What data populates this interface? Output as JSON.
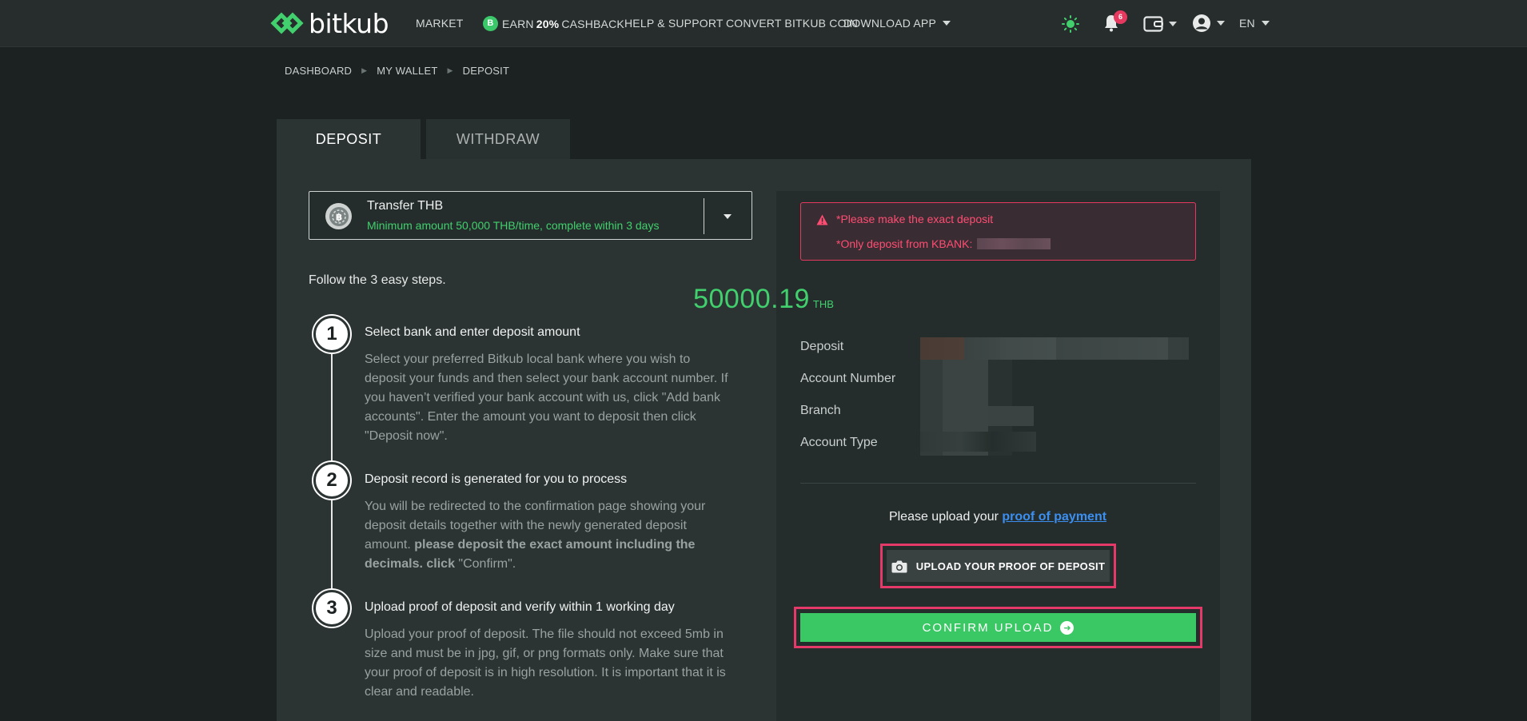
{
  "brand": {
    "name": "bitkub"
  },
  "nav": {
    "market": "MARKET",
    "earn_prefix": "EARN",
    "earn_bold": "20%",
    "earn_suffix": "CASHBACK",
    "earn_coin": "B",
    "help": "HELP & SUPPORT",
    "convert": "CONVERT BITKUB COIN",
    "download": "DOWNLOAD APP",
    "notifications_count": "6",
    "language": "EN"
  },
  "breadcrumb": [
    "DASHBOARD",
    "MY WALLET",
    "DEPOSIT"
  ],
  "tabs": {
    "deposit": "DEPOSIT",
    "withdraw": "WITHDRAW"
  },
  "method": {
    "title": "Transfer THB",
    "subtitle": "Minimum amount 50,000 THB/time, complete within 3 days"
  },
  "steps_intro": "Follow the 3 easy steps.",
  "steps": [
    {
      "num": "1",
      "title": "Select bank and enter deposit amount",
      "desc": "Select your preferred Bitkub local bank where you wish to deposit your funds and then select your bank account number. If you haven’t verified your bank account with us, click \"Add bank accounts\". Enter the amount you want to deposit then click \"Deposit now\"."
    },
    {
      "num": "2",
      "title": "Deposit record is generated for you to process",
      "desc_pre": "You will be redirected to the confirmation page showing your deposit details together with the newly generated deposit amount. ",
      "desc_bold": "please deposit the exact amount including the decimals. click",
      "desc_post": " \"Confirm\"."
    },
    {
      "num": "3",
      "title": "Upload proof of deposit and verify within 1 working day",
      "desc": "Upload your proof of deposit. The file should not exceed 5mb in size and must be in jpg, gif, or png formats only. Make sure that your proof of deposit is in high resolution. It is important that it is clear and readable."
    }
  ],
  "alert": {
    "line1": "*Please make the exact deposit",
    "line2": "*Only deposit from KBANK:"
  },
  "amount": {
    "value": "50000.19",
    "unit": "THB"
  },
  "details": {
    "deposit_label": "Deposit",
    "account_number_label": "Account Number",
    "branch_label": "Branch",
    "account_type_label": "Account Type"
  },
  "upload": {
    "prompt": "Please upload your",
    "link": "proof of payment",
    "button": "UPLOAD YOUR PROOF OF DEPOSIT"
  },
  "confirm": {
    "label": "CONFIRM UPLOAD"
  },
  "colors": {
    "accent_green": "#41d06d",
    "alert_red": "#e5395f",
    "link_blue": "#3b8ff0",
    "highlight_pink": "#e5396a"
  }
}
